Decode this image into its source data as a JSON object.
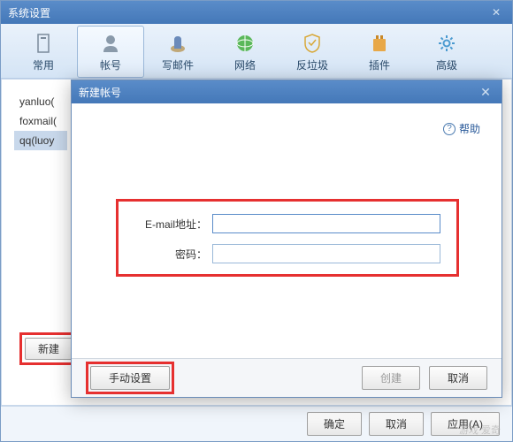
{
  "window": {
    "title": "系统设置"
  },
  "toolbar": {
    "items": [
      {
        "label": "常用"
      },
      {
        "label": "帐号"
      },
      {
        "label": "写邮件"
      },
      {
        "label": "网络"
      },
      {
        "label": "反垃圾"
      },
      {
        "label": "插件"
      },
      {
        "label": "高级"
      }
    ]
  },
  "accounts": {
    "items": [
      {
        "label": "yanluo("
      },
      {
        "label": "foxmail("
      },
      {
        "label": "qq(luoy"
      }
    ]
  },
  "buttons": {
    "new": "新建",
    "ok": "确定",
    "cancel": "取消",
    "apply": "应用(A)"
  },
  "modal": {
    "title": "新建帐号",
    "help": "帮助",
    "email_label": "E-mail地址：",
    "password_label": "密码：",
    "email_value": "",
    "password_value": "",
    "manual": "手动设置",
    "create": "创建",
    "cancel": "取消"
  },
  "watermark": "游戏 爱奇"
}
